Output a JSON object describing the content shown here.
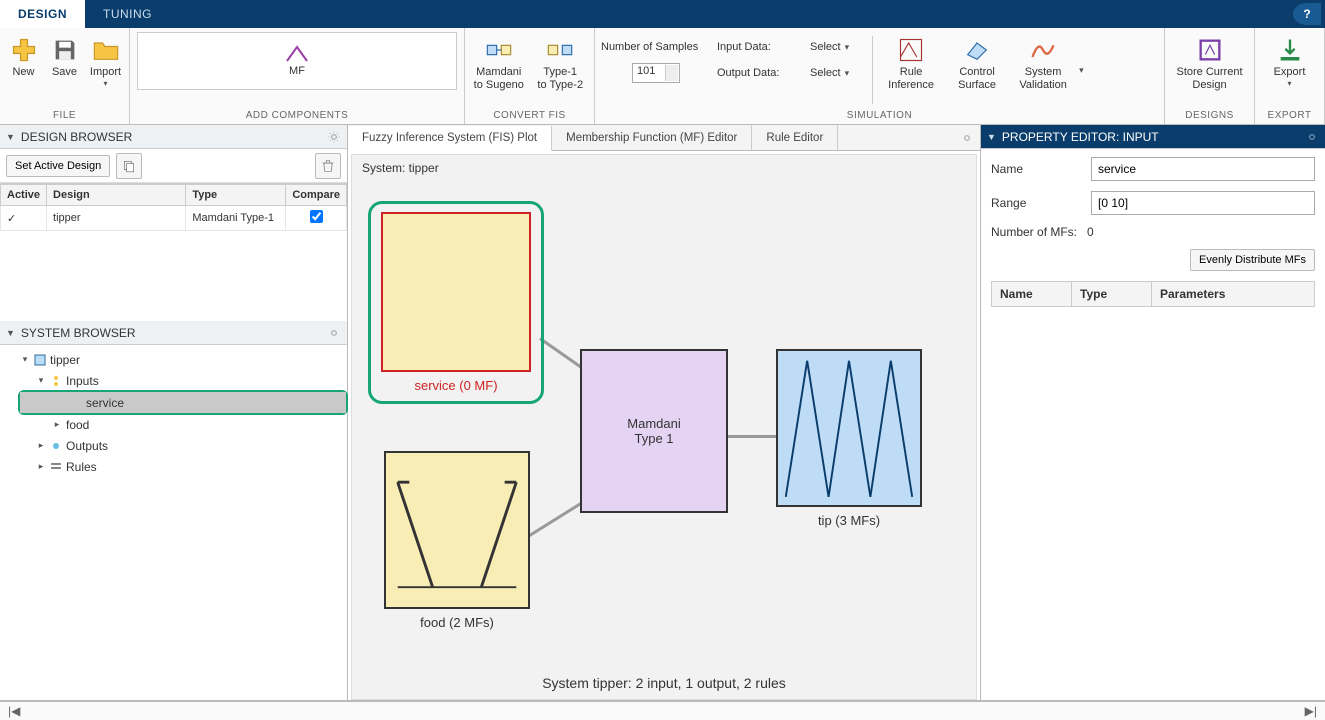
{
  "tabs": {
    "design": "DESIGN",
    "tuning": "TUNING"
  },
  "ribbon": {
    "file": {
      "label": "FILE",
      "new": "New",
      "save": "Save",
      "import": "Import"
    },
    "add": {
      "label": "ADD COMPONENTS",
      "mf": "MF"
    },
    "convert": {
      "label": "CONVERT FIS",
      "mamdani": "Mamdani\nto Sugeno",
      "type1": "Type-1\nto Type-2"
    },
    "sim": {
      "label": "SIMULATION",
      "nsamples_label": "Number of Samples",
      "nsamples_value": "101",
      "input_label": "Input Data:",
      "input_value": "Select",
      "output_label": "Output Data:",
      "output_value": "Select",
      "ruleinf": "Rule\nInference",
      "ctrlsurf": "Control\nSurface",
      "sysval": "System\nValidation"
    },
    "designs": {
      "label": "DESIGNS",
      "store": "Store Current\nDesign"
    },
    "export": {
      "label": "EXPORT",
      "export": "Export"
    }
  },
  "design_browser": {
    "title": "DESIGN BROWSER",
    "set_active": "Set Active Design",
    "cols": {
      "active": "Active",
      "design": "Design",
      "type": "Type",
      "compare": "Compare"
    },
    "rows": [
      {
        "active": "✓",
        "design": "tipper",
        "type": "Mamdani Type-1",
        "compare": true
      }
    ]
  },
  "system_browser": {
    "title": "SYSTEM BROWSER",
    "root": "tipper",
    "inputs_label": "Inputs",
    "outputs_label": "Outputs",
    "rules_label": "Rules",
    "inputs": [
      "service",
      "food"
    ]
  },
  "doc_tabs": {
    "fis": "Fuzzy Inference System (FIS) Plot",
    "mf": "Membership Function (MF) Editor",
    "rule": "Rule Editor"
  },
  "canvas": {
    "system_label": "System: tipper",
    "service_caption": "service (0 MF)",
    "food_caption": "food (2 MFs)",
    "sys_caption": "Mamdani\nType 1",
    "tip_caption": "tip (3 MFs)",
    "summary": "System tipper: 2 input, 1 output, 2 rules"
  },
  "prop": {
    "title": "PROPERTY EDITOR: INPUT",
    "name_label": "Name",
    "name_value": "service",
    "range_label": "Range",
    "range_value": "[0 10]",
    "nummf_label": "Number of MFs:",
    "nummf_value": "0",
    "evenbtn": "Evenly Distribute MFs",
    "cols": {
      "name": "Name",
      "type": "Type",
      "params": "Parameters"
    }
  },
  "status": {
    "left": "|◀",
    "right": "▶|"
  }
}
